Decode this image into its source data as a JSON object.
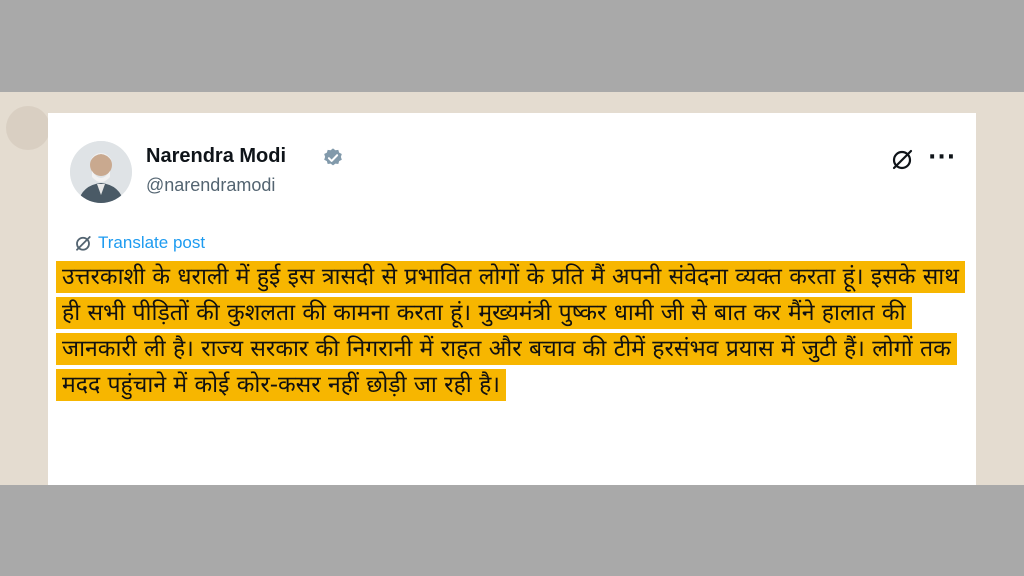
{
  "post": {
    "author_name": "Narendra Modi",
    "author_handle": "@narendramodi",
    "translate_label": "Translate post",
    "text": "उत्तरकाशी के धराली में हुई इस त्रासदी से प्रभावित लोगों के प्रति मैं अपनी संवेदना व्यक्त करता हूं। इसके साथ ही सभी पीड़ितों की कुशलता की कामना करता हूं। मुख्यमंत्री पुष्कर धामी जी से बात कर मैंने हालात की जानकारी ली है। राज्य सरकार की निगरानी में राहत और बचाव की टीमें हरसंभव प्रयास में जुटी हैं। लोगों तक मदद पहुंचाने में कोई कोर-कसर नहीं छोड़ी जा रही है।",
    "highlight_color": "#f7b600"
  },
  "icons": {
    "verified": "verified-badge-icon",
    "grok": "grok-icon",
    "more": "more-icon",
    "translate": "translate-icon"
  },
  "colors": {
    "link_blue": "#1d9bf0",
    "verified_gray": "#829aab"
  }
}
